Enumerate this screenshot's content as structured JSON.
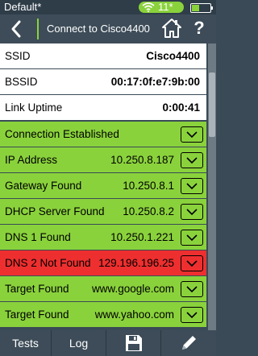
{
  "statusbar": {
    "title": "Default*",
    "wifi_count": "11*",
    "battery_level": 0.4
  },
  "header": {
    "title": "Connect to Cisco4400"
  },
  "info_rows": [
    {
      "label": "SSID",
      "value": "Cisco4400"
    },
    {
      "label": "BSSID",
      "value": "00:17:0f:e7:9b:00"
    },
    {
      "label": "Link Uptime",
      "value": "0:00:41"
    }
  ],
  "status_rows": [
    {
      "label": "Connection Established",
      "value": "",
      "state": "green"
    },
    {
      "label": "IP Address",
      "value": "10.250.8.187",
      "state": "green"
    },
    {
      "label": "Gateway Found",
      "value": "10.250.8.1",
      "state": "green"
    },
    {
      "label": "DHCP Server Found",
      "value": "10.250.8.2",
      "state": "green"
    },
    {
      "label": "DNS 1 Found",
      "value": "10.250.1.221",
      "state": "green"
    },
    {
      "label": "DNS 2 Not Found",
      "value": "129.196.196.25",
      "state": "red"
    },
    {
      "label": "Target Found",
      "value": "www.google.com",
      "state": "green"
    },
    {
      "label": "Target Found",
      "value": "www.yahoo.com",
      "state": "green"
    }
  ],
  "bottombar": {
    "tests_label": "Tests",
    "log_label": "Log",
    "save_icon": "save-icon",
    "edit_icon": "edit-icon"
  },
  "colors": {
    "ok": "#8ad23c",
    "fail": "#ee2f2f",
    "chrome": "#3d4c58"
  }
}
